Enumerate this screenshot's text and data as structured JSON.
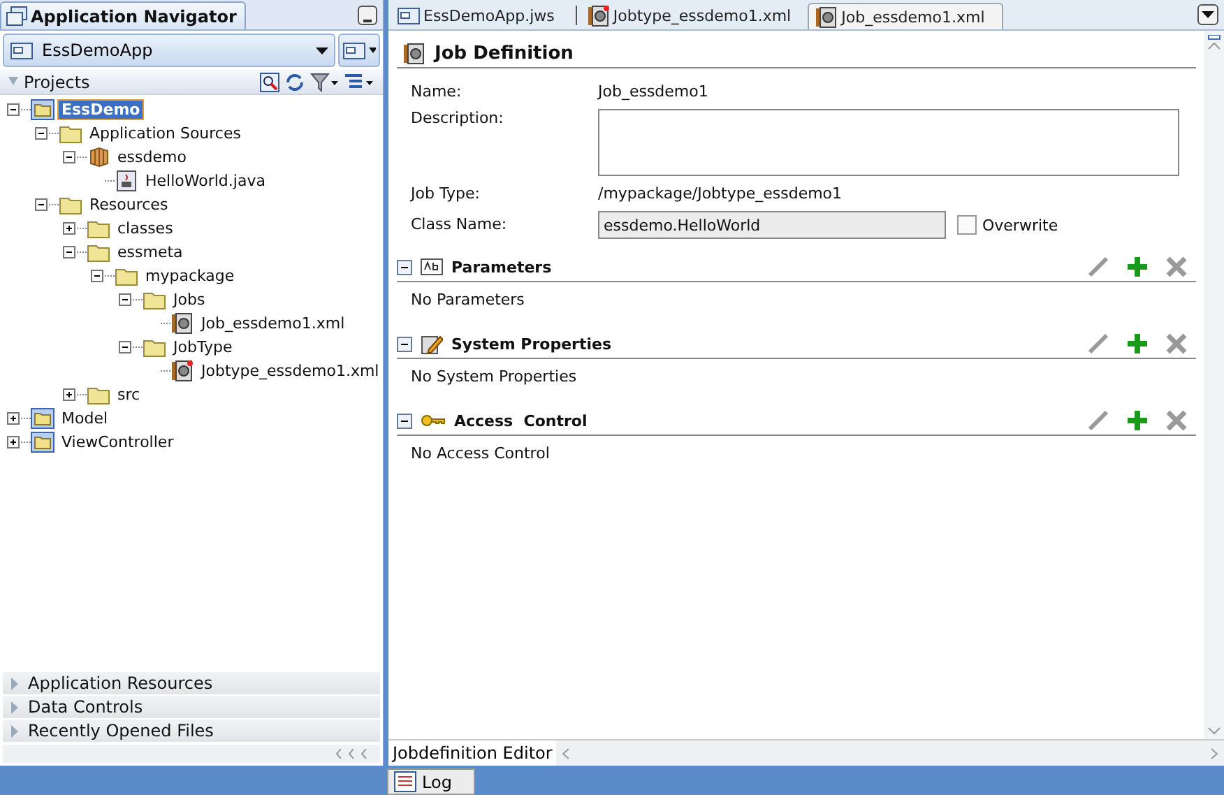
{
  "navigator": {
    "title": "Application Navigator",
    "application": "EssDemoApp",
    "projects_label": "Projects",
    "tree": [
      {
        "label": "EssDemo",
        "kind": "project",
        "selected": true,
        "expanded": true,
        "children": [
          {
            "label": "Application Sources",
            "kind": "folder",
            "selected": false,
            "expanded": true,
            "children": [
              {
                "label": "essdemo",
                "kind": "package",
                "selected": false,
                "expanded": true,
                "children": [
                  {
                    "label": "HelloWorld.java",
                    "kind": "java",
                    "selected": false
                  }
                ]
              }
            ]
          },
          {
            "label": "Resources",
            "kind": "folder",
            "selected": false,
            "expanded": true,
            "children": [
              {
                "label": "classes",
                "kind": "folder",
                "selected": false,
                "expanded": false
              },
              {
                "label": "essmeta",
                "kind": "folder",
                "selected": false,
                "expanded": true,
                "children": [
                  {
                    "label": "mypackage",
                    "kind": "folder",
                    "selected": false,
                    "expanded": true,
                    "children": [
                      {
                        "label": "Jobs",
                        "kind": "folder",
                        "selected": false,
                        "expanded": true,
                        "children": [
                          {
                            "label": "Job_essdemo1.xml",
                            "kind": "job",
                            "selected": false
                          }
                        ]
                      },
                      {
                        "label": "JobType",
                        "kind": "folder",
                        "selected": false,
                        "expanded": true,
                        "children": [
                          {
                            "label": "Jobtype_essdemo1.xml",
                            "kind": "jobtype",
                            "selected": false
                          }
                        ]
                      }
                    ]
                  }
                ]
              },
              {
                "label": "src",
                "kind": "folder",
                "selected": false,
                "expanded": false
              }
            ]
          }
        ]
      },
      {
        "label": "Model",
        "kind": "project",
        "selected": false,
        "expanded": false
      },
      {
        "label": "ViewController",
        "kind": "project",
        "selected": false,
        "expanded": false
      }
    ],
    "accordions": [
      {
        "label": "Application Resources",
        "expanded": false
      },
      {
        "label": "Data Controls",
        "expanded": false
      },
      {
        "label": "Recently Opened Files",
        "expanded": false
      }
    ]
  },
  "editor": {
    "tabs": [
      {
        "label": "EssDemoApp.jws",
        "kind": "app",
        "selected": false
      },
      {
        "label": "Jobtype_essdemo1.xml",
        "kind": "jobtype",
        "selected": false
      },
      {
        "label": "Job_essdemo1.xml",
        "kind": "job",
        "selected": true
      }
    ],
    "heading": "Job Definition",
    "fields": [
      {
        "kind": "text",
        "label": "Name:",
        "value": "Job_essdemo1"
      },
      {
        "kind": "textarea",
        "label": "Description:"
      },
      {
        "kind": "text",
        "label": "Job Type:",
        "value": "/mypackage/Jobtype_essdemo1"
      },
      {
        "kind": "readonly",
        "label": "Class Name:",
        "value": "essdemo.HelloWorld",
        "checkbox": {
          "label": "Overwrite",
          "checked": false
        }
      }
    ],
    "sections": [
      {
        "title": "Parameters",
        "kind": "params",
        "expanded": true,
        "empty_text": "No Parameters"
      },
      {
        "title": "System Properties",
        "kind": "props",
        "expanded": true,
        "empty_text": "No System Properties"
      },
      {
        "title": "Access  Control",
        "kind": "key",
        "expanded": true,
        "empty_text": "No Access Control"
      }
    ],
    "bottom_tab": "Jobdefinition Editor"
  },
  "log_tab": "Log"
}
